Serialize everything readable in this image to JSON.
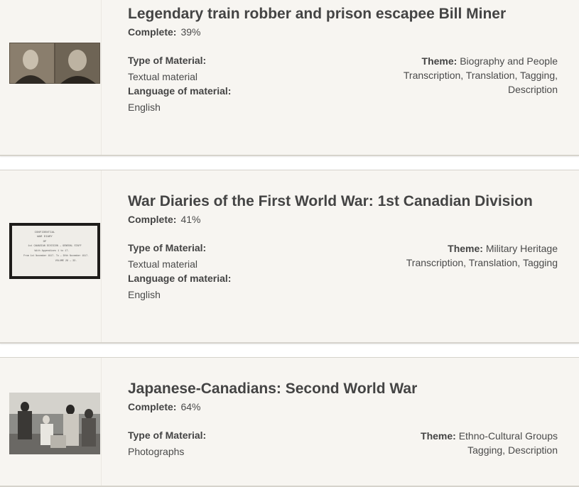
{
  "items": [
    {
      "title": "Legendary train robber and prison escapee Bill Miner",
      "complete_label": "Complete:",
      "complete_value": "39%",
      "type_label": "Type of Material:",
      "type_value": "Textual material",
      "language_label": "Language of material:",
      "language_value": "English",
      "theme_label": "Theme:",
      "theme_value": "Biography and People",
      "tasks": "Transcription, Translation, Tagging, Description",
      "thumbnail": "mugshot-photo"
    },
    {
      "title": "War Diaries of the First World War: 1st Canadian Division",
      "complete_label": "Complete:",
      "complete_value": "41%",
      "type_label": "Type of Material:",
      "type_value": "Textual material",
      "language_label": "Language of material:",
      "language_value": "English",
      "theme_label": "Theme:",
      "theme_value": "Military Heritage",
      "tasks": "Transcription, Translation, Tagging",
      "thumbnail": "typed-document",
      "doc_lines": [
        "CONFIDENTIAL",
        "WAR DIARY",
        "OF",
        "1st CANADIAN DIVISION — GENERAL STAFF",
        "With Appendices 1 to 17.",
        "From 1st November 1917.   To — 30th November 1917.",
        "VOLUME 28 — 33."
      ]
    },
    {
      "title": "Japanese-Canadians: Second World War",
      "complete_label": "Complete:",
      "complete_value": "64%",
      "type_label": "Type of Material:",
      "type_value": "Photographs",
      "theme_label": "Theme:",
      "theme_value": "Ethno-Cultural Groups",
      "tasks": "Tagging, Description",
      "thumbnail": "group-photo"
    }
  ]
}
